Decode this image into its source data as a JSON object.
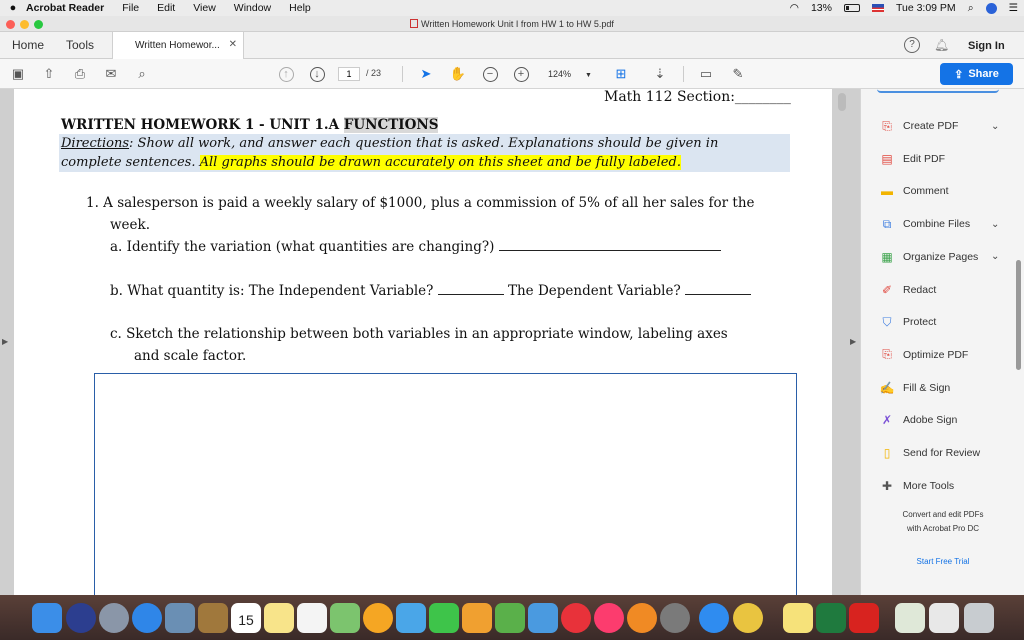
{
  "menubar": {
    "app_name": "Acrobat Reader",
    "menus": [
      "File",
      "Edit",
      "View",
      "Window",
      "Help"
    ],
    "battery": "13%",
    "clock": "Tue 3:09 PM"
  },
  "window": {
    "title": "Written Homework Unit I from HW 1 to HW 5.pdf"
  },
  "tabs": {
    "home": "Home",
    "tools": "Tools",
    "doc_tab": "Written Homewor...",
    "sign_in": "Sign In"
  },
  "toolbar": {
    "page_current": "1",
    "page_total": "/ 23",
    "zoom": "124%",
    "share": "Share"
  },
  "document": {
    "section_line": "Math 112 Section:________",
    "title_main": "WRITTEN HOMEWORK 1 -  UNIT 1.A ",
    "title_highlight": "FUNCTIONS",
    "directions_label": "Directions",
    "directions_text": ":  Show all work, and answer each question that is asked.  Explanations should be given in",
    "directions_text2": "complete sentences.  ",
    "directions_highlight": "All graphs should be drawn accurately on this sheet and be fully labeled.",
    "q1_line1": "1.   A salesperson is paid a weekly salary of $1000, plus a commission of 5% of all her sales for the",
    "q1_line2": "week.",
    "qa": "a.   Identify the variation (what quantities are changing?)",
    "qb_part1": "b.   What quantity is: The Independent Variable?",
    "qb_part2": "The Dependent Variable?",
    "qc_line1": "c.    Sketch the relationship between both variables in an appropriate window, labeling axes",
    "qc_line2": "and scale factor."
  },
  "right_panel": {
    "tools": [
      {
        "label": "Create PDF",
        "icon": "create-pdf-icon",
        "color": "#e0463d",
        "chevron": true
      },
      {
        "label": "Edit PDF",
        "icon": "edit-pdf-icon",
        "color": "#e0463d",
        "chevron": false
      },
      {
        "label": "Comment",
        "icon": "comment-icon",
        "color": "#f2b400",
        "chevron": false
      },
      {
        "label": "Combine Files",
        "icon": "combine-files-icon",
        "color": "#3a7be0",
        "chevron": true
      },
      {
        "label": "Organize Pages",
        "icon": "organize-pages-icon",
        "color": "#3aa24a",
        "chevron": true
      },
      {
        "label": "Redact",
        "icon": "redact-icon",
        "color": "#e0463d",
        "chevron": false
      },
      {
        "label": "Protect",
        "icon": "protect-icon",
        "color": "#3a7be0",
        "chevron": false
      },
      {
        "label": "Optimize PDF",
        "icon": "optimize-pdf-icon",
        "color": "#e0463d",
        "chevron": false
      },
      {
        "label": "Fill & Sign",
        "icon": "fill-sign-icon",
        "color": "#7a4fd6",
        "chevron": false
      },
      {
        "label": "Adobe Sign",
        "icon": "adobe-sign-icon",
        "color": "#7a4fd6",
        "chevron": false
      },
      {
        "label": "Send for Review",
        "icon": "send-review-icon",
        "color": "#f2b400",
        "chevron": false
      },
      {
        "label": "More Tools",
        "icon": "more-tools-icon",
        "color": "#555555",
        "chevron": false
      }
    ],
    "promo_line1": "Convert and edit PDFs",
    "promo_line2": "with Acrobat Pro DC",
    "trial": "Start Free Trial"
  },
  "dock": {
    "calendar_day": "15"
  }
}
